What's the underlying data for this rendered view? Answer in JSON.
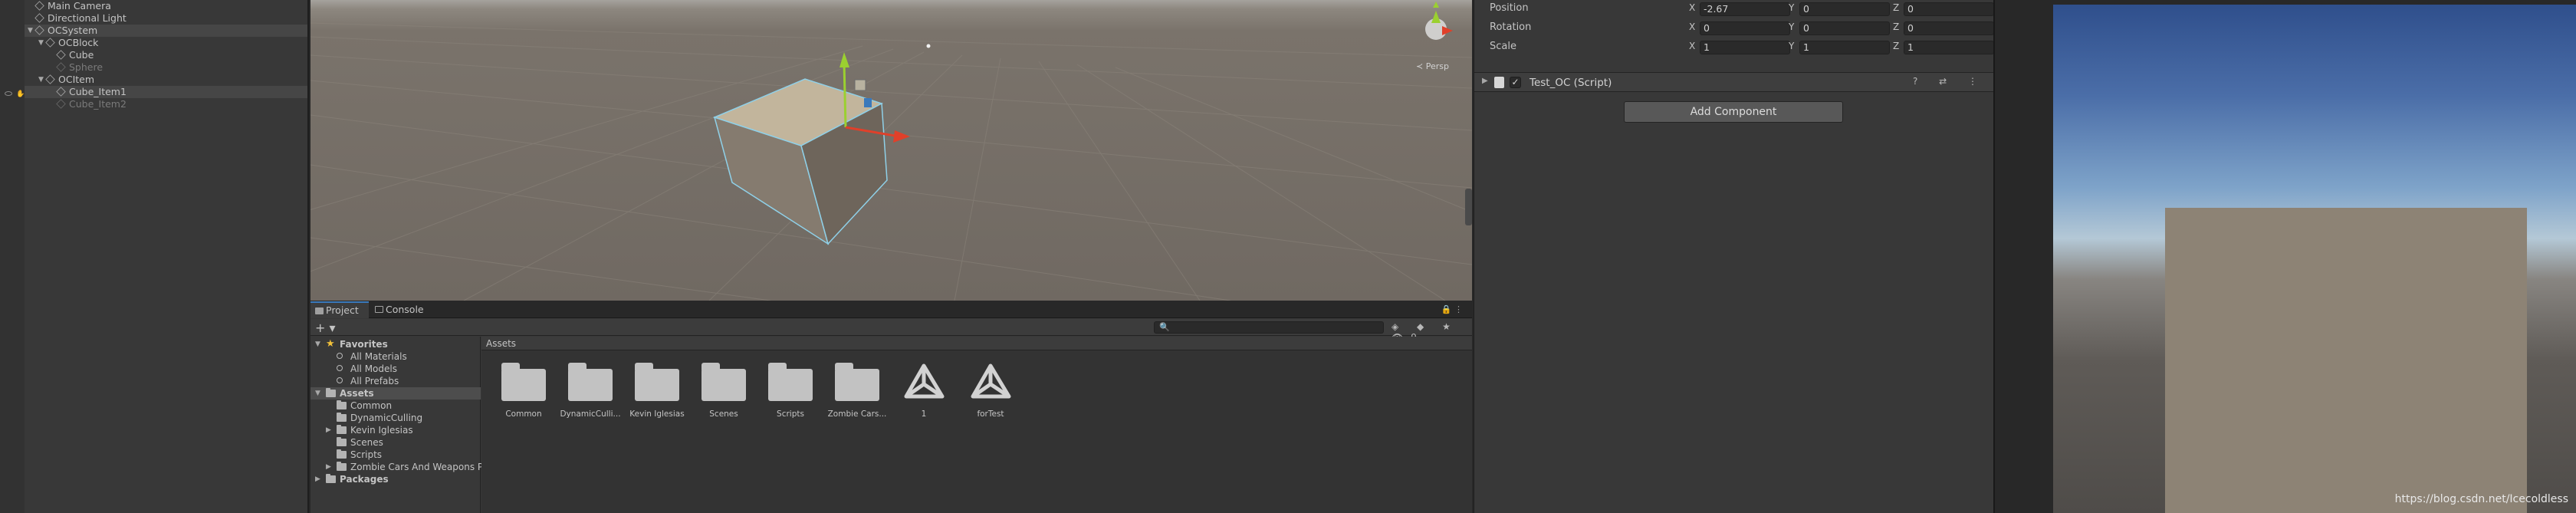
{
  "hierarchy": {
    "items": [
      {
        "label": "Main Camera",
        "depth": 1,
        "arrow": "",
        "selected": false,
        "dim": false
      },
      {
        "label": "Directional Light",
        "depth": 1,
        "arrow": "",
        "selected": false,
        "dim": false
      },
      {
        "label": "OCSystem",
        "depth": 1,
        "arrow": "▼",
        "selected": true,
        "dim": false
      },
      {
        "label": "OCBlock",
        "depth": 2,
        "arrow": "▼",
        "selected": false,
        "dim": false
      },
      {
        "label": "Cube",
        "depth": 3,
        "arrow": "",
        "selected": false,
        "dim": false
      },
      {
        "label": "Sphere",
        "depth": 3,
        "arrow": "",
        "selected": false,
        "dim": true
      },
      {
        "label": "OCItem",
        "depth": 2,
        "arrow": "▼",
        "selected": false,
        "dim": false
      },
      {
        "label": "Cube_Item1",
        "depth": 3,
        "arrow": "",
        "selected": true,
        "dim": false
      },
      {
        "label": "Cube_Item2",
        "depth": 3,
        "arrow": "",
        "selected": false,
        "dim": true
      }
    ]
  },
  "scene": {
    "persp_label": "≺ Persp"
  },
  "project": {
    "tabs": [
      {
        "label": "Project",
        "active": true,
        "icon": "folder-icon"
      },
      {
        "label": "Console",
        "active": false,
        "icon": "console-icon"
      }
    ],
    "plus_label": "+ ▾",
    "search_placeholder": "🔍",
    "toolbar_icons": "◈ ◆ ★ 👁9",
    "tree": [
      {
        "label": "Favorites",
        "kind": "favorites",
        "bold": true,
        "arrow": "▼",
        "indent": 0
      },
      {
        "label": "All Materials",
        "kind": "search",
        "bold": false,
        "arrow": "",
        "indent": 1
      },
      {
        "label": "All Models",
        "kind": "search",
        "bold": false,
        "arrow": "",
        "indent": 1
      },
      {
        "label": "All Prefabs",
        "kind": "search",
        "bold": false,
        "arrow": "",
        "indent": 1
      },
      {
        "label": "Assets",
        "kind": "folder",
        "bold": true,
        "arrow": "▼",
        "indent": 0,
        "selected": true
      },
      {
        "label": "Common",
        "kind": "folder",
        "bold": false,
        "arrow": "",
        "indent": 1
      },
      {
        "label": "DynamicCulling",
        "kind": "folder",
        "bold": false,
        "arrow": "",
        "indent": 1
      },
      {
        "label": "Kevin Iglesias",
        "kind": "folder",
        "bold": false,
        "arrow": "▶",
        "indent": 1
      },
      {
        "label": "Scenes",
        "kind": "folder",
        "bold": false,
        "arrow": "",
        "indent": 1
      },
      {
        "label": "Scripts",
        "kind": "folder",
        "bold": false,
        "arrow": "",
        "indent": 1
      },
      {
        "label": "Zombie Cars And Weapons Pac",
        "kind": "folder",
        "bold": false,
        "arrow": "▶",
        "indent": 1
      },
      {
        "label": "Packages",
        "kind": "folder",
        "bold": true,
        "arrow": "▶",
        "indent": 0
      }
    ],
    "assets_header": "Assets",
    "assets": [
      {
        "label": "Common",
        "kind": "folder"
      },
      {
        "label": "DynamicCulli...",
        "kind": "folder"
      },
      {
        "label": "Kevin Iglesias",
        "kind": "folder"
      },
      {
        "label": "Scenes",
        "kind": "folder"
      },
      {
        "label": "Scripts",
        "kind": "folder"
      },
      {
        "label": "Zombie Cars...",
        "kind": "folder"
      },
      {
        "label": "1",
        "kind": "unity"
      },
      {
        "label": "forTest",
        "kind": "unity"
      }
    ]
  },
  "inspector": {
    "transform": [
      {
        "label": "Position",
        "x": "-2.67",
        "y": "0",
        "z": "0"
      },
      {
        "label": "Rotation",
        "x": "0",
        "y": "0",
        "z": "0"
      },
      {
        "label": "Scale",
        "x": "1",
        "y": "1",
        "z": "1"
      }
    ],
    "axis_labels": [
      "X",
      "Y",
      "Z"
    ],
    "component": {
      "title": "Test_OC (Script)",
      "checkbox": "✓",
      "icons": "? ⇄ ⋮",
      "arrow": "▶"
    },
    "add_component_label": "Add Component"
  },
  "game": {
    "watermark": "https://blog.csdn.net/Icecoldless"
  },
  "colors": {
    "accent": "#3a79bb",
    "panel": "#383838",
    "selection": "#464646"
  }
}
